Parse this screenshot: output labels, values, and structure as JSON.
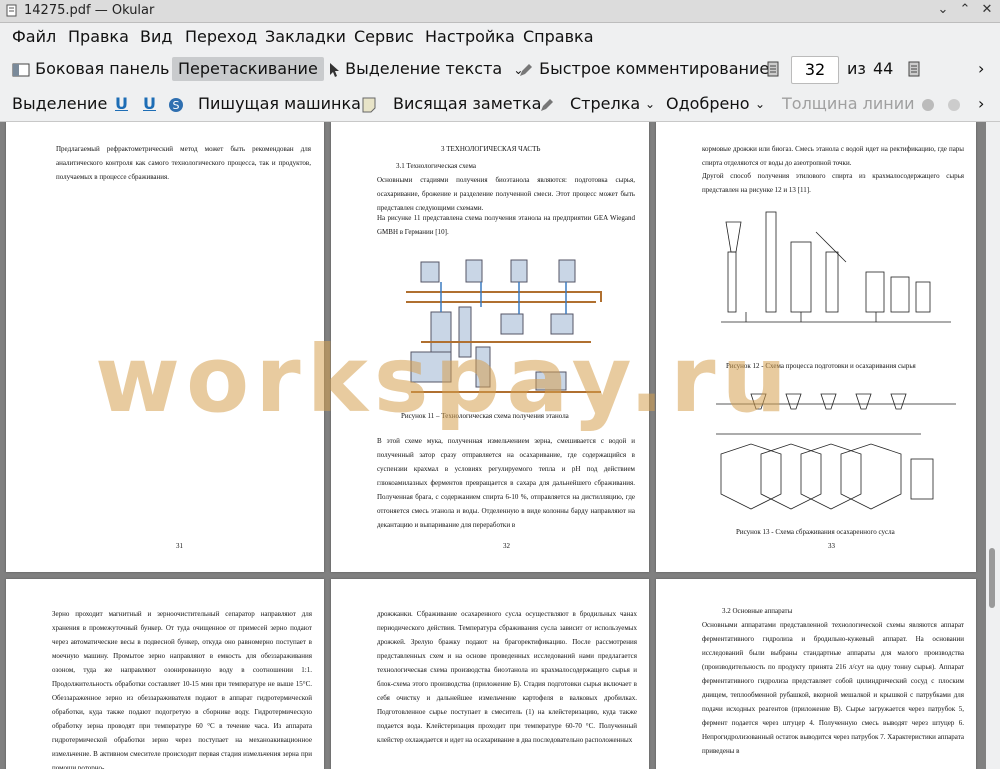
{
  "window": {
    "title": "14275.pdf — Okular"
  },
  "menu": [
    "Файл",
    "Правка",
    "Вид",
    "Переход",
    "Закладки",
    "Сервис",
    "Настройка",
    "Справка"
  ],
  "toolbar1": {
    "sidebar": "Боковая панель",
    "drag": "Перетаскивание",
    "text_select": "Выделение текста",
    "quick_comment": "Быстрое комментирование",
    "page_current": "32",
    "page_of": "из",
    "page_total": "44"
  },
  "toolbar2": {
    "highlight": "Выделение",
    "typewriter": "Пишущая машинка",
    "sticky_note": "Висящая заметка",
    "arrow": "Стрелка",
    "approved": "Одобрено",
    "line_width": "Толщина линии"
  },
  "watermark": "workspay.ru",
  "pages": {
    "p31": {
      "text": "Предлагаемый рефрактометрический метод может быть рекомендован для аналитического контроля как самого технологического процесса, так и продуктов, получаемых в процессе сбраживания.",
      "num": "31"
    },
    "p32": {
      "heading": "3 ТЕХНОЛОГИЧЕСКАЯ ЧАСТЬ",
      "subheading": "3.1 Технологическая схема",
      "para1": "Основными стадиями получения биоэтанола являются: подготовка сырья, осахаривание, брожение и разделение полученной смеси. Этот процесс может быть представлен следующими схемами.",
      "para2": "На рисунке 11 представлена схема получения этанола на предприятии GEA Wiegand GMBH в Германии [10].",
      "caption": "Рисунок 11 – Технологическая схема получения этанола",
      "para3": "В этой схеме мука, полученная измельчением зерна, смешивается с водой и полученный затор сразу отправляется на осахаривание, где содержащийся в суспензии крахмал в условиях регулируемого тепла и pH под действием глюкоамилазных ферментов превращается в сахара для дальнейшего сбраживания. Полученная брага, с содержанием спирта 6-10 %, отправляется на дистилляцию, где отгоняется смесь этанола и воды. Отделенную в виде колонны барду направляют на декантацию и выпаривание для переработки в",
      "num": "32"
    },
    "p33": {
      "para1": "кормовые дрожжи или биогаз. Смесь этанола с водой идет на ректификацию, где пары спирта отделяются от воды до азеотропной точки.",
      "para2": "Другой способ получения этилового спирта из крахмалосодержащего сырья представлен на рисунке 12 и 13 [11].",
      "caption12": "Рисунок 12 - Схема процесса подготовки и осахаривания сырья",
      "caption13": "Рисунок 13 - Схема сбраживания осахаренного сусла",
      "num": "33"
    },
    "p34": {
      "text": "Зерно проходит магнитный и зерноочистительный сепаратор направляют для хранения в промежуточный бункер. От туда очищенное от примесей зерно подают через автоматические весы в подвесной бункер, откуда оно равномерно поступает в моечную машину. Промытое зерно направляют в емкость для обеззараживания озоном, туда же направляют озонированную воду в соотношении 1:1. Продолжительность обработки составляет 10-15 мин при температуре не выше 15°С. Обеззараженное зерно из обеззараживателя подают в аппарат гидротермической обработки, куда также подают подогретую в сборнике воду. Гидротермическую обработку зерна проводят при температуре 60 °С в течение часа. Из аппарата гидротермической обработки зерно через поступает на механоакивационное измельчение. В активном смесителе происходит первая стадия измельчения зерна при помощи роторно-"
    },
    "p35": {
      "text": "дрожжанки. Сбраживание осахаренного сусла осуществляют в бродильных чанах периодического действия. Температура сбраживания сусла зависит от используемых дрожжей. Зрелую бражку подают на брагоректификацию. После рассмотрения представленных схем и на основе проведенных исследований нами предлагается технологическая схема производства биоэтанола из крахмалосодержащего сырья и блок-схема этого производства (приложение Б). Стадия подготовки сырья включает в себя очистку и дальнейшее измельчение картофеля в валковых дробилках. Подготовленное сырье поступает в смеситель (1) на клейстеризацию, куда также подается вода. Клейстеризация проходит при температуре 60-70 °С. Полученный клейстер охлаждается и идет на осахаривание в два последовательно расположенных"
    },
    "p36": {
      "heading": "3.2 Основные аппараты",
      "text": "Основными аппаратами представленной технологической схемы являются аппарат ферментативного гидролиза и бродильно-кужевый аппарат. На основании исследований были выбраны стандартные аппараты для малого производства (производительность по продукту принята 216 л/сут на одну тонну сырья). Аппарат ферментативного гидролиза представляет собой цилиндрический сосуд с плоским днищем, теплообменной рубашкой, вкорной мешалкой и крышкой с патрубками для подачи исходных реагентов (приложение В). Сырье загружается через патрубок 5, фермент подается через штуцер 4. Полученную смесь выводят через штуцер 6. Непрогидролизованный остаток выводится через патрубок 7. Характеристики аппарата приведены в"
    }
  }
}
